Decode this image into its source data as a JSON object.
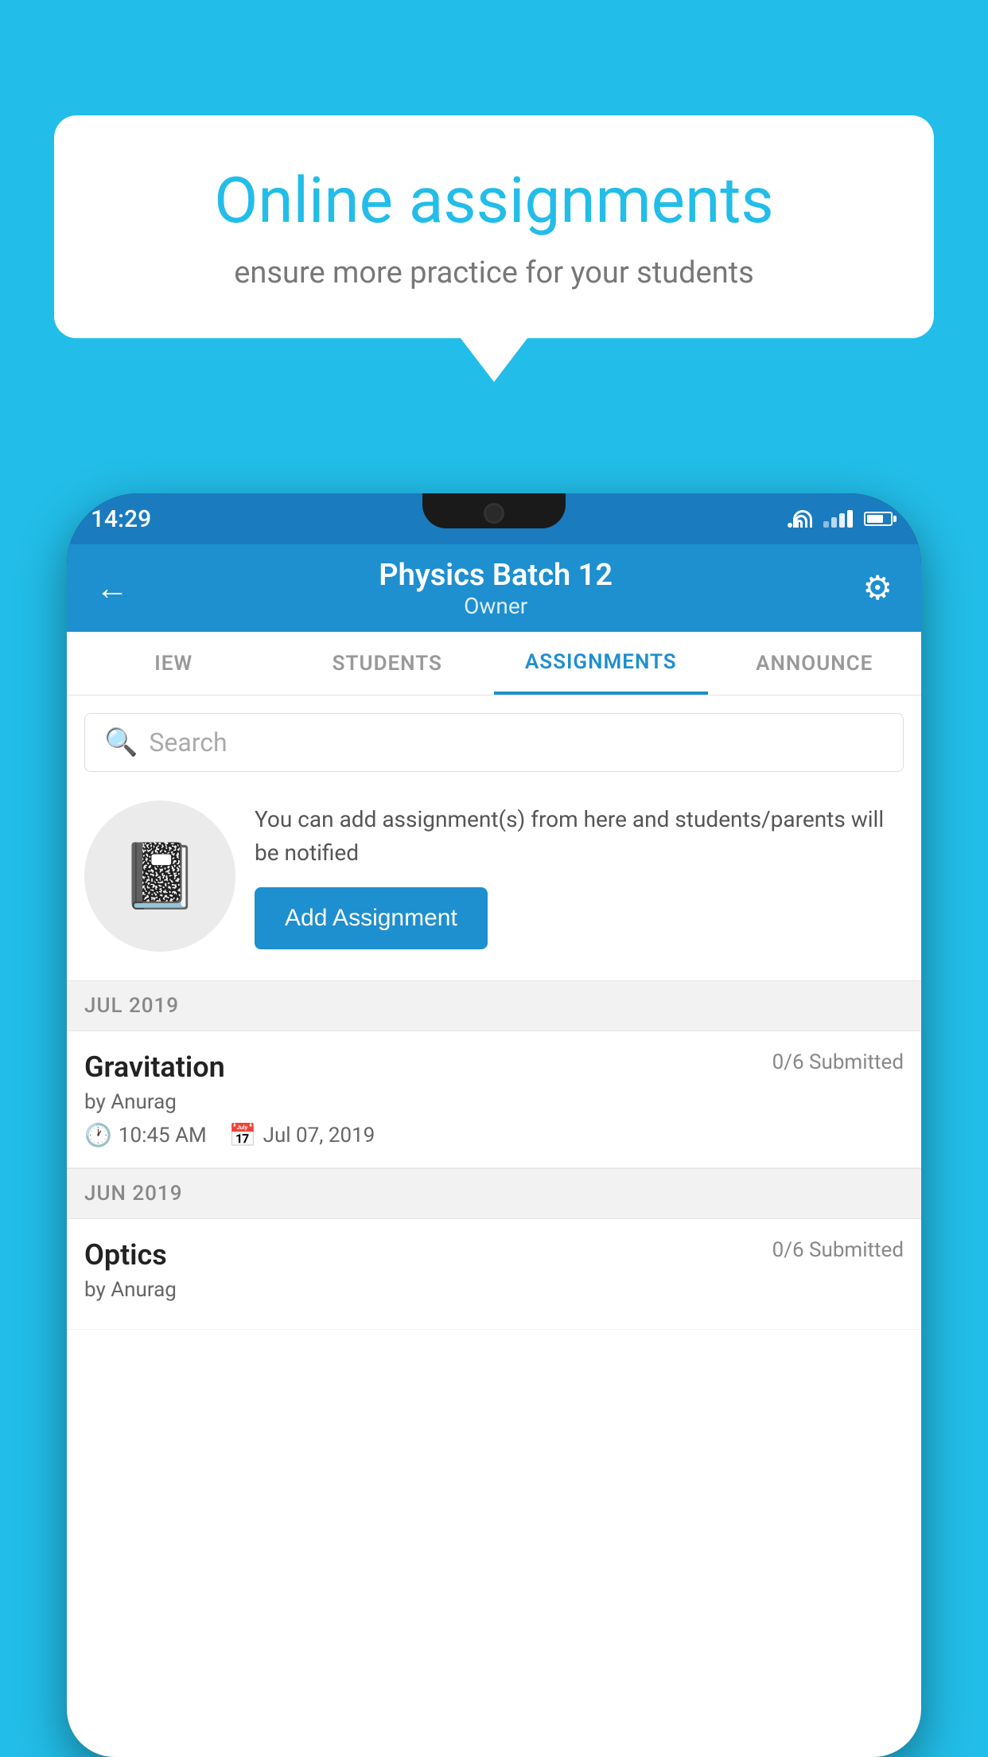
{
  "background_color": "#22bde8",
  "speech_bubble": {
    "title": "Online assignments",
    "subtitle": "ensure more practice for your students"
  },
  "status_bar": {
    "time": "14:29"
  },
  "app_bar": {
    "title": "Physics Batch 12",
    "subtitle": "Owner",
    "back_label": "←",
    "settings_label": "⚙"
  },
  "tabs": [
    {
      "label": "IEW",
      "active": false
    },
    {
      "label": "STUDENTS",
      "active": false
    },
    {
      "label": "ASSIGNMENTS",
      "active": true
    },
    {
      "label": "ANNOUNCE",
      "active": false
    }
  ],
  "search": {
    "placeholder": "Search"
  },
  "empty_state": {
    "description": "You can add assignment(s) from here and students/parents will be notified",
    "button_label": "Add Assignment"
  },
  "sections": [
    {
      "label": "JUL 2019",
      "assignments": [
        {
          "title": "Gravitation",
          "submitted": "0/6 Submitted",
          "author": "by Anurag",
          "time": "10:45 AM",
          "date": "Jul 07, 2019"
        }
      ]
    },
    {
      "label": "JUN 2019",
      "assignments": [
        {
          "title": "Optics",
          "submitted": "0/6 Submitted",
          "author": "by Anurag",
          "time": "",
          "date": ""
        }
      ]
    }
  ]
}
